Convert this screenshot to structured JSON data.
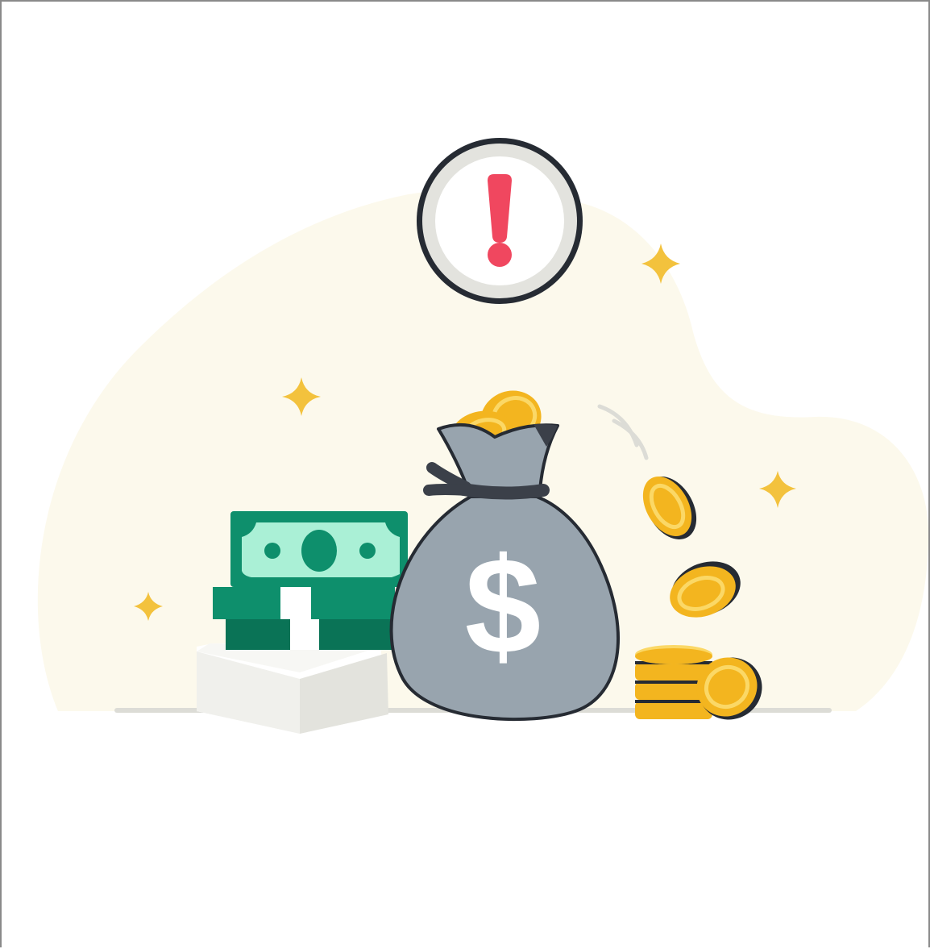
{
  "illustration": {
    "alert_symbol": "!",
    "currency_symbol": "$",
    "icons": {
      "alert": "exclamation-icon",
      "sparkle": "sparkle-icon",
      "money_bag": "money-bag-icon",
      "banknote": "banknote-icon",
      "coin": "coin-icon"
    },
    "colors": {
      "background": "#ffffff",
      "blob": "#fcf9ec",
      "alert_red": "#f0475f",
      "alert_ring": "#e3e3de",
      "outline": "#262b33",
      "sparkle": "#f3c23d",
      "bill_green": "#0e8f6c",
      "bill_dark": "#0a7356",
      "bill_light": "#aaf0d6",
      "bag_gray": "#98a4ae",
      "bag_tie": "#3b4049",
      "coin_gold": "#f3b51f",
      "coin_light": "#fbd866",
      "ground": "#dcdcd6",
      "box_light": "#f0f0ec",
      "box_shadow": "#dcdcd6"
    }
  }
}
